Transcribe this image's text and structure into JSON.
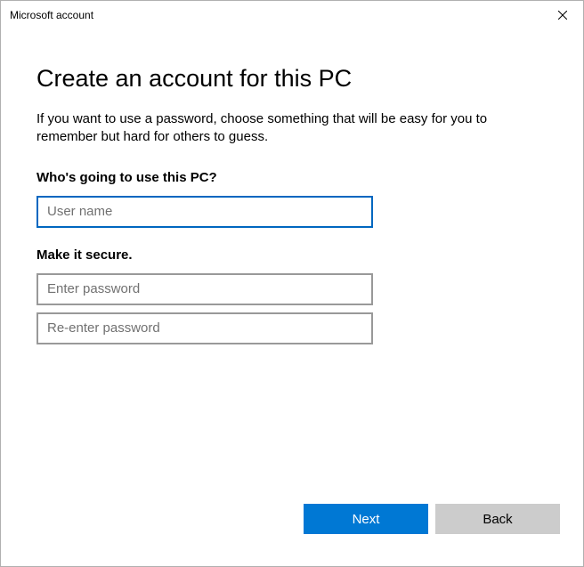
{
  "titlebar": {
    "title": "Microsoft account"
  },
  "page": {
    "title": "Create an account for this PC",
    "description": "If you want to use a password, choose something that will be easy for you to remember but hard for others to guess."
  },
  "username": {
    "label": "Who's going to use this PC?",
    "placeholder": "User name",
    "value": ""
  },
  "password": {
    "label": "Make it secure.",
    "enter_placeholder": "Enter password",
    "reenter_placeholder": "Re-enter password",
    "value1": "",
    "value2": ""
  },
  "buttons": {
    "next": "Next",
    "back": "Back"
  }
}
